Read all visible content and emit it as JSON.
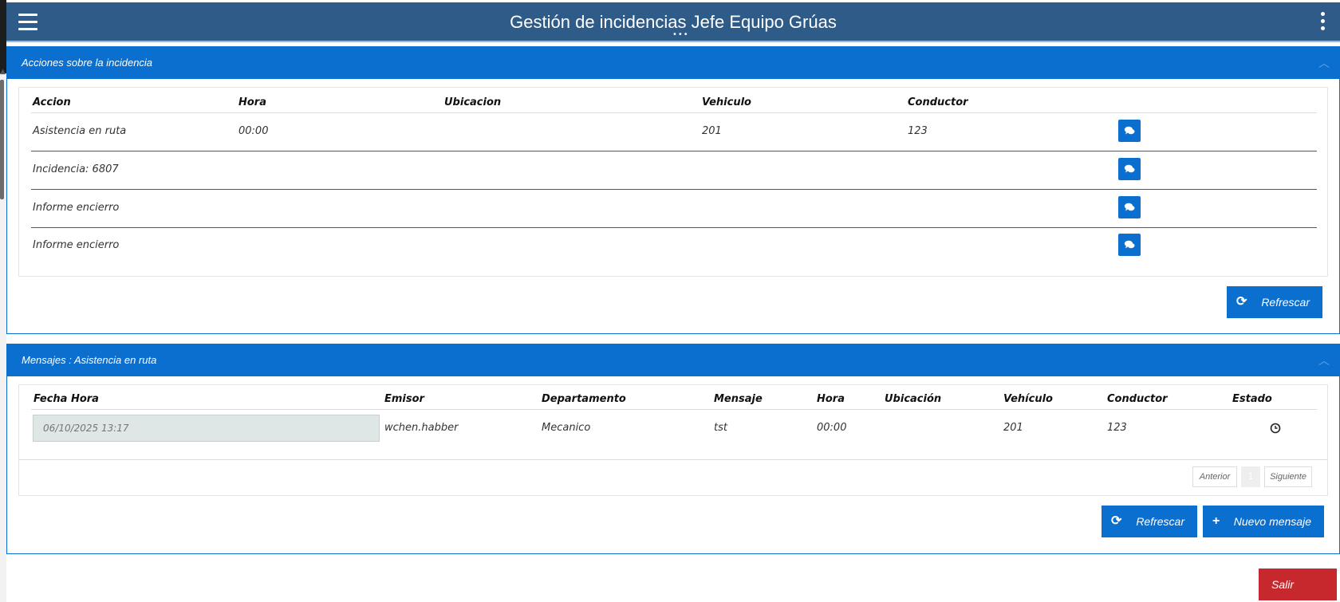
{
  "header": {
    "title": "Gestión de incidencias Jefe Equipo Grúas"
  },
  "acciones": {
    "title": "Acciones sobre la incidencia",
    "columns": [
      "Accion",
      "Hora",
      "Ubicacion",
      "Vehiculo",
      "Conductor"
    ],
    "rows": [
      {
        "accion": "Asistencia en ruta",
        "hora": "00:00",
        "ubicacion": "",
        "vehiculo": "201",
        "conductor": "123"
      },
      {
        "accion": "Incidencia: 6807",
        "hora": "",
        "ubicacion": "",
        "vehiculo": "",
        "conductor": ""
      },
      {
        "accion": "Informe encierro",
        "hora": "",
        "ubicacion": "",
        "vehiculo": "",
        "conductor": ""
      },
      {
        "accion": "Informe encierro",
        "hora": "",
        "ubicacion": "",
        "vehiculo": "",
        "conductor": ""
      }
    ],
    "refresh_label": "Refrescar"
  },
  "mensajes": {
    "title": "Mensajes : Asistencia en ruta",
    "columns": [
      "Fecha Hora",
      "Emisor",
      "Departamento",
      "Mensaje",
      "Hora",
      "Ubicación",
      "Vehículo",
      "Conductor",
      "Estado"
    ],
    "row": {
      "fecha_hora": "06/10/2025 13:17",
      "emisor": "wchen.habber",
      "departamento": "Mecanico",
      "mensaje": "tst",
      "hora": "00:00",
      "ubicacion": "",
      "vehiculo": "201",
      "conductor": "123",
      "estado_icon": "clock-icon"
    },
    "pager": {
      "prev": "Anterior",
      "page": "1",
      "next": "Siguiente"
    },
    "refresh_label": "Refrescar",
    "new_label": "Nuevo mensaje"
  },
  "exit_label": "Salir",
  "colors": {
    "topbar": "#2e5b87",
    "accent": "#0b6fd0",
    "danger": "#c7282d"
  }
}
